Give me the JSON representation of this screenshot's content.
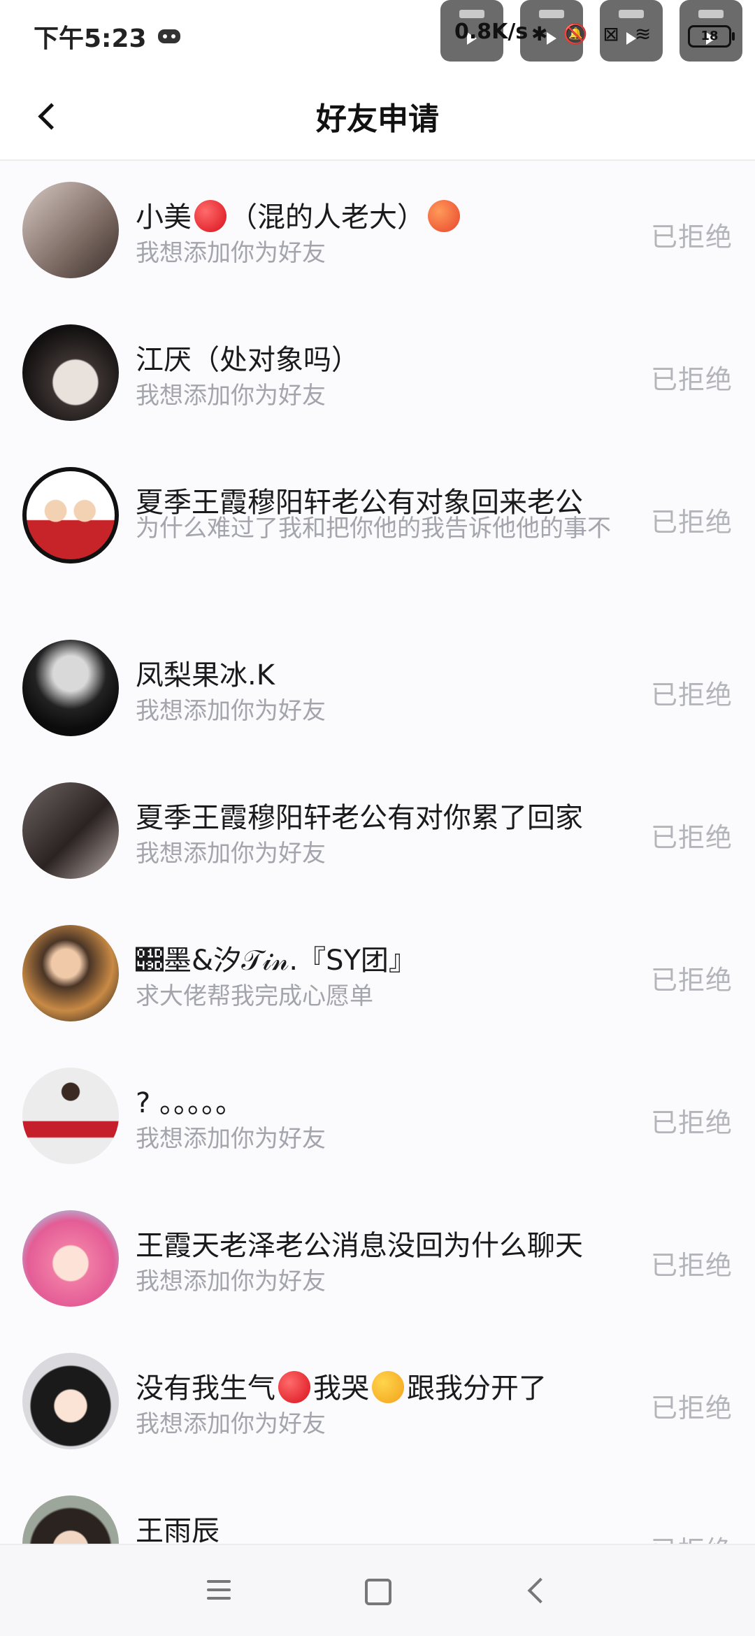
{
  "status_bar": {
    "time": "下午5:23",
    "net_speed": "0.8K/s",
    "battery": "18",
    "icons": [
      "game-controller-icon",
      "bluetooth-icon",
      "bell-off-icon",
      "sim-off-icon",
      "wifi-icon",
      "battery-icon"
    ]
  },
  "header": {
    "title": "好友申请"
  },
  "requests": [
    {
      "name_before": "小美",
      "name_middle": "（混的人老大）",
      "name_after": "",
      "message": "我想添加你为好友",
      "status": "已拒绝"
    },
    {
      "name": "江厌（处对象吗）",
      "message": "我想添加你为好友",
      "status": "已拒绝"
    },
    {
      "name": "夏季王霞穆阳轩老公有对象回来老公",
      "message": "为什么难过了我和把你他的我告诉他他的事不",
      "status": "已拒绝"
    },
    {
      "name": "凤梨果冰.K",
      "message": "我想添加你为好友",
      "status": "已拒绝"
    },
    {
      "name": "夏季王霞穆阳轩老公有对你累了回家",
      "message": "我想添加你为好友",
      "status": "已拒绝"
    },
    {
      "name": "𝒝墨&汐𝒯𝒾𝓃.『SY团』",
      "message": "求大佬帮我完成心愿单",
      "status": "已拒绝"
    },
    {
      "name": "? 。。。。。",
      "message": "我想添加你为好友",
      "status": "已拒绝"
    },
    {
      "name": "王霞天老泽老公消息没回为什么聊天",
      "message": "我想添加你为好友",
      "status": "已拒绝"
    },
    {
      "name_before": "没有我生气",
      "name_middle": "我哭",
      "name_after": "跟我分开了",
      "message": "我想添加你为好友",
      "status": "已拒绝"
    },
    {
      "name": "王雨辰",
      "message": "",
      "status": "已拒绝"
    }
  ],
  "colors": {
    "status_gray": "#b4b4bb",
    "message_gray": "#a4a4ad",
    "title_black": "#111111"
  }
}
